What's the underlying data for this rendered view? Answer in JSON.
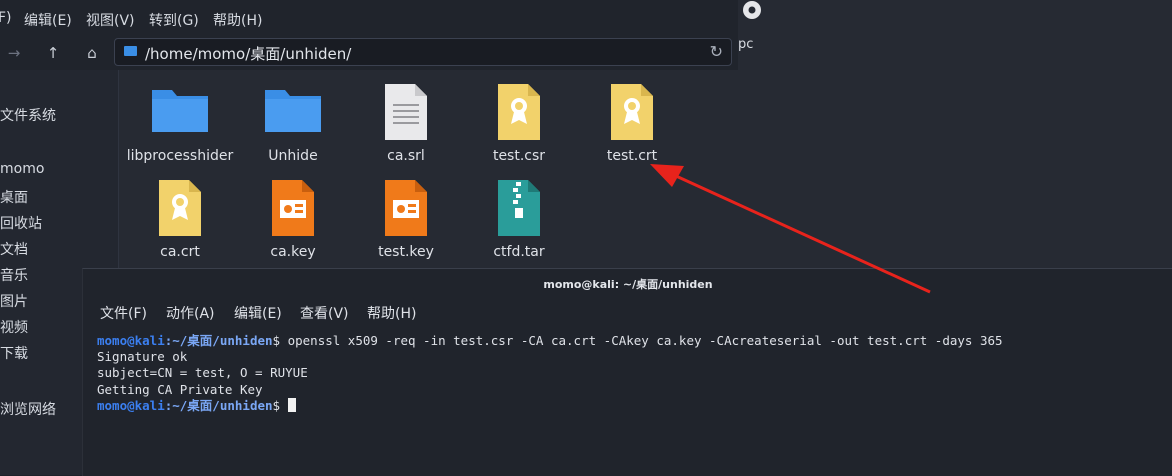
{
  "file_manager": {
    "menu": [
      "F)",
      "编辑(E)",
      "视图(V)",
      "转到(G)",
      "帮助(H)"
    ],
    "path": "/home/momo/桌面/unhiden/",
    "sidebar": [
      "文件系统",
      "momo",
      "桌面",
      "回收站",
      "文档",
      "音乐",
      "图片",
      "视频",
      "下载",
      "浏览网络"
    ],
    "files": [
      {
        "name": "libprocesshider",
        "type": "folder"
      },
      {
        "name": "Unhide",
        "type": "folder"
      },
      {
        "name": "ca.srl",
        "type": "text"
      },
      {
        "name": "test.csr",
        "type": "certificate"
      },
      {
        "name": "test.crt",
        "type": "certificate"
      },
      {
        "name": "ca.crt",
        "type": "certificate"
      },
      {
        "name": "ca.key",
        "type": "key"
      },
      {
        "name": "test.key",
        "type": "key"
      },
      {
        "name": "ctfd.tar",
        "type": "archive"
      }
    ]
  },
  "desktop": {
    "icon_label": "pc"
  },
  "terminal": {
    "title": "momo@kali: ~/桌面/unhiden",
    "menu": [
      "文件(F)",
      "动作(A)",
      "编辑(E)",
      "查看(V)",
      "帮助(H)"
    ],
    "prompt_user": "momo@kali",
    "prompt_path": ":~/桌面/unhiden",
    "prompt_symbol": "$",
    "command": " openssl x509 -req -in test.csr -CA ca.crt -CAkey ca.key -CAcreateserial -out test.crt -days 365",
    "output": [
      "Signature ok",
      "subject=CN = test, O = RUYUE",
      "Getting CA Private Key"
    ]
  },
  "colors": {
    "arrow": "#e8231c",
    "folder": "#3a8ee6",
    "cert": "#f2d26b",
    "key": "#f07a1a",
    "archive": "#2a9d9a"
  }
}
